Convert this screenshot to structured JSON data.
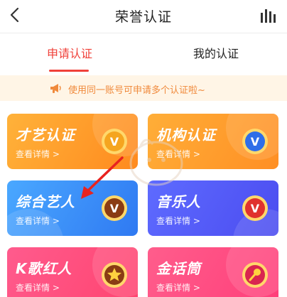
{
  "header": {
    "title": "荣誉认证",
    "back_icon": "back-chevron-icon",
    "rank_icon": "bar-rank-icon"
  },
  "tabs": [
    {
      "label": "申请认证",
      "active": true
    },
    {
      "label": "我的认证",
      "active": false
    }
  ],
  "notice": {
    "text": "使用同一账号可申请多个认证啦~",
    "icon": "megaphone-icon"
  },
  "cards": [
    {
      "title": "才艺认证",
      "detail": "查看详情 >",
      "badge": "V"
    },
    {
      "title": "机构认证",
      "detail": "查看详情 >",
      "badge": "V"
    },
    {
      "title": "综合艺人",
      "detail": "查看详情 >",
      "badge": "V"
    },
    {
      "title": "音乐人",
      "detail": "查看详情 >",
      "badge": "V"
    },
    {
      "title": "K歌红人",
      "detail": "查看详情 >",
      "badge": "star-icon"
    },
    {
      "title": "金话筒",
      "detail": "查看详情 >",
      "badge": "microphone-icon"
    }
  ],
  "colors": {
    "accent": "#f0413a",
    "notice_bg": "#fff5e6",
    "notice_text": "#f08a3c"
  }
}
